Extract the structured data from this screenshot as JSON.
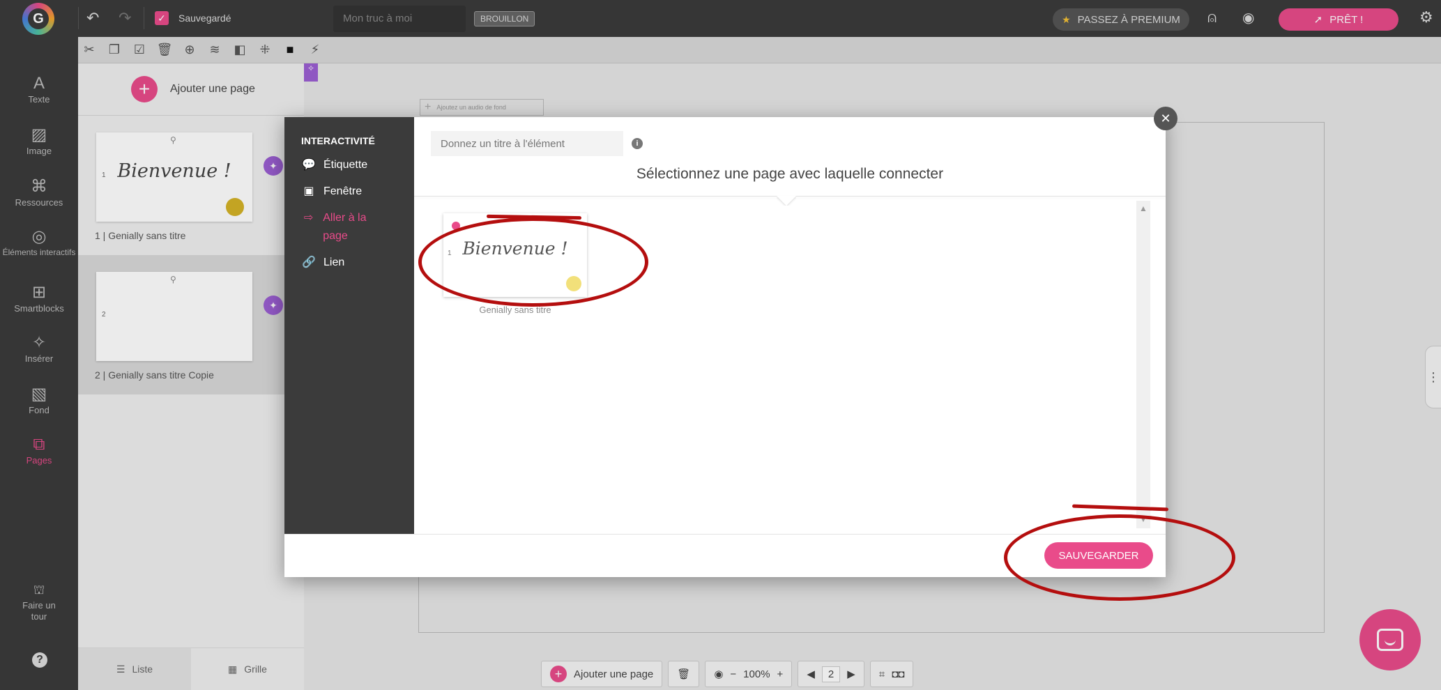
{
  "topbar": {
    "logo_letter": "G",
    "saved_label": "Sauvegardé",
    "project_title_placeholder": "Mon truc à moi",
    "draft_badge": "BROUILLON",
    "premium_label": "PASSEZ À PREMIUM",
    "ready_label": "PRÊT !"
  },
  "sidebar": {
    "items": [
      {
        "label": "Texte",
        "icon": "text-icon"
      },
      {
        "label": "Image",
        "icon": "image-icon"
      },
      {
        "label": "Ressources",
        "icon": "resources-icon"
      },
      {
        "label": "Éléments interactifs",
        "icon": "interactive-icon"
      },
      {
        "label": "Smartblocks",
        "icon": "smartblocks-icon"
      },
      {
        "label": "Insérer",
        "icon": "insert-icon"
      },
      {
        "label": "Fond",
        "icon": "background-icon"
      },
      {
        "label": "Pages",
        "icon": "pages-icon"
      }
    ],
    "tour_label": "Faire un tour"
  },
  "pages_panel": {
    "add_page_label": "Ajouter une page",
    "pages": [
      {
        "number": "1",
        "caption": "1 | Genially sans titre",
        "text": "Bienvenue !"
      },
      {
        "number": "2",
        "caption": "2 | Genially sans titre Copie",
        "text": ""
      }
    ],
    "list_label": "Liste",
    "grid_label": "Grille"
  },
  "canvas": {
    "audio_chip": "Ajoutez un audio de fond"
  },
  "modal": {
    "section_title": "INTERACTIVITÉ",
    "options": [
      {
        "label": "Étiquette",
        "icon": "tooltip-icon"
      },
      {
        "label": "Fenêtre",
        "icon": "window-icon"
      },
      {
        "label": "Aller à la page",
        "icon": "goto-page-icon"
      },
      {
        "label": "Lien",
        "icon": "link-icon"
      }
    ],
    "title_placeholder": "Donnez un titre à l'élément",
    "heading": "Sélectionnez une page avec laquelle connecter",
    "target_page": {
      "text": "Bienvenue !",
      "caption": "Genially sans titre",
      "number": "1"
    },
    "save_label": "SAUVEGARDER"
  },
  "bottom_bar": {
    "add_page_label": "Ajouter une page",
    "zoom": "100%",
    "zoom_minus": "−",
    "zoom_plus": "+",
    "page_number": "2"
  },
  "colors": {
    "accent": "#e94b8a",
    "dark": "#3b3b3b",
    "annotation_red": "#b40e0e"
  }
}
